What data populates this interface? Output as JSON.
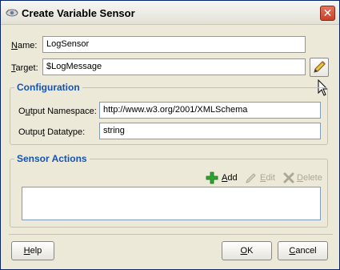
{
  "window": {
    "title": "Create Variable Sensor",
    "close_symbol": "✕"
  },
  "form": {
    "name_label_key": "N",
    "name_label_rest": "ame:",
    "name_value": "LogSensor",
    "target_label_key": "T",
    "target_label_rest": "arget:",
    "target_value": "$LogMessage"
  },
  "configuration": {
    "title": "Configuration",
    "namespace_label_pre": "O",
    "namespace_label_key": "u",
    "namespace_label_rest": "tput Namespace:",
    "namespace_value": "http://www.w3.org/2001/XMLSchema",
    "datatype_label_pre": "Outpu",
    "datatype_label_key": "t",
    "datatype_label_rest": " Datatype:",
    "datatype_value": "string"
  },
  "sensor_actions": {
    "title": "Sensor Actions",
    "add_key": "A",
    "add_rest": "dd",
    "edit_key": "E",
    "edit_rest": "dit",
    "delete_key": "D",
    "delete_rest": "elete"
  },
  "buttons": {
    "help_key": "H",
    "help_rest": "elp",
    "ok_key": "O",
    "ok_rest": "K",
    "cancel_key": "C",
    "cancel_rest": "ancel"
  },
  "icons": {
    "title": "sensor-icon",
    "browse": "pencil-icon",
    "add": "plus-icon",
    "edit": "pencil-icon",
    "delete": "x-icon",
    "cursor": "mouse-pointer-icon"
  },
  "colors": {
    "group_title": "#1553b1",
    "add_icon": "#2fa52f",
    "disabled_text": "#aca899",
    "close_button": "#c6432a"
  }
}
